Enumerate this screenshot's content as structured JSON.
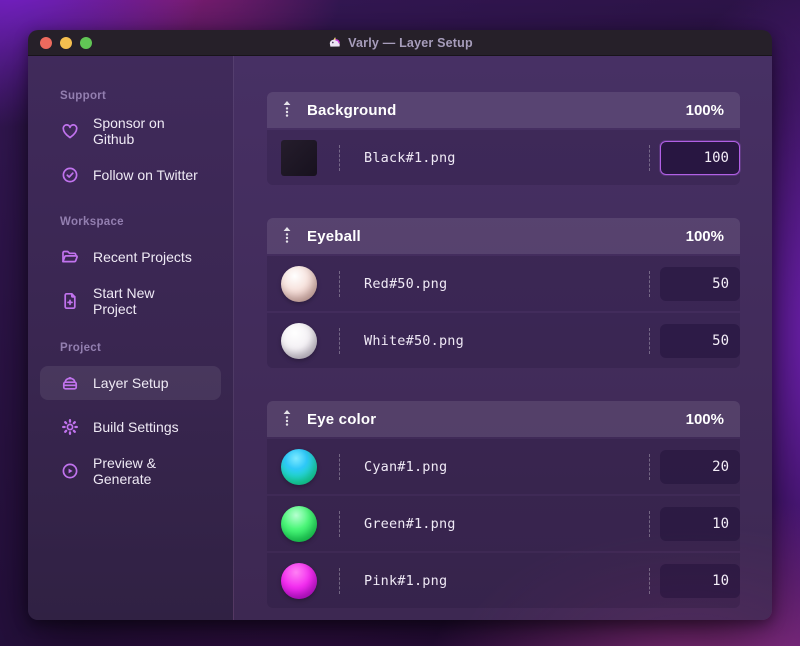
{
  "window": {
    "title": "Varly — Layer Setup",
    "app_icon": "unicorn-icon"
  },
  "titlebar_buttons": {
    "close": "close",
    "minimize": "minimize",
    "zoom": "zoom"
  },
  "sidebar": {
    "sections": [
      {
        "label": "Support",
        "items": [
          {
            "label": "Sponsor on Github",
            "icon": "heart-icon"
          },
          {
            "label": "Follow on Twitter",
            "icon": "verified-badge-icon"
          }
        ]
      },
      {
        "label": "Workspace",
        "items": [
          {
            "label": "Recent Projects",
            "icon": "folder-open-icon"
          },
          {
            "label": "Start New Project",
            "icon": "document-plus-icon"
          }
        ]
      },
      {
        "label": "Project",
        "items": [
          {
            "label": "Layer Setup",
            "icon": "layers-icon",
            "active": true
          },
          {
            "label": "Build Settings",
            "icon": "gear-icon"
          },
          {
            "label": "Preview & Generate",
            "icon": "play-circle-icon"
          }
        ]
      }
    ]
  },
  "layer_groups": [
    {
      "name": "Background",
      "weight": "100%",
      "layers": [
        {
          "file": "Black#1.png",
          "value": "100",
          "thumbnail": "black-square",
          "focused": true
        }
      ]
    },
    {
      "name": "Eyeball",
      "weight": "100%",
      "layers": [
        {
          "file": "Red#50.png",
          "value": "50",
          "thumbnail": "red-sphere"
        },
        {
          "file": "White#50.png",
          "value": "50",
          "thumbnail": "white-sphere"
        }
      ]
    },
    {
      "name": "Eye color",
      "weight": "100%",
      "layers": [
        {
          "file": "Cyan#1.png",
          "value": "20",
          "thumbnail": "cyan-sphere"
        },
        {
          "file": "Green#1.png",
          "value": "10",
          "thumbnail": "green-sphere"
        },
        {
          "file": "Pink#1.png",
          "value": "10",
          "thumbnail": "pink-sphere"
        }
      ]
    }
  ],
  "colors": {
    "accent": "#c173ee",
    "focused_input_border": "#b160e5",
    "traffic_close": "#ed6a5e",
    "traffic_minimize": "#f5bf4f",
    "traffic_zoom": "#61c555",
    "cyan_thumb": "#2fc8f8",
    "green_thumb": "#2ee95c",
    "pink_thumb": "#e32cf0"
  }
}
